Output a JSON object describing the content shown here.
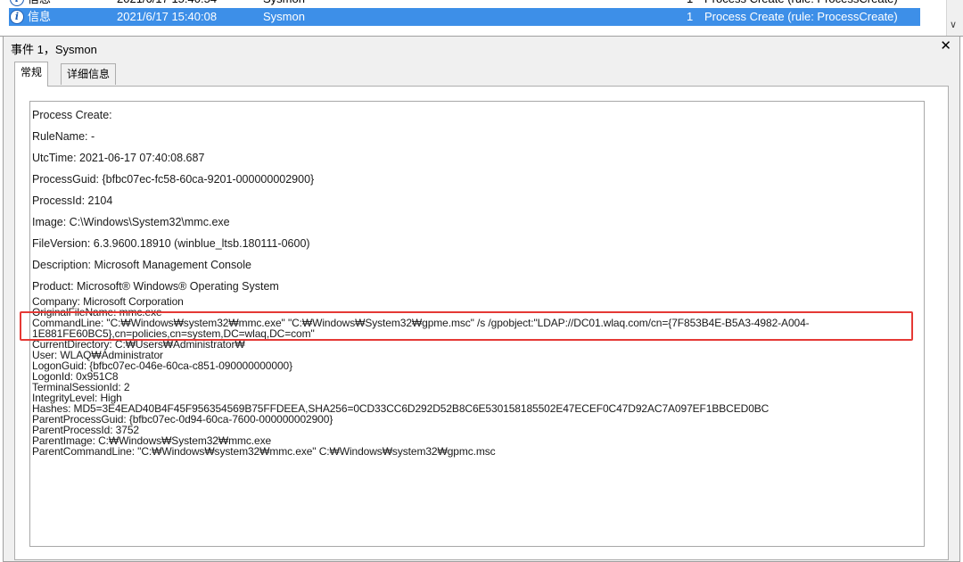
{
  "event_list": {
    "rows": [
      {
        "level": "信息",
        "datetime": "2021/6/17 15:40:54",
        "source": "Sysmon",
        "event_id": "1",
        "task_category": "Process Create (rule: ProcessCreate)",
        "selected": false
      },
      {
        "level": "信息",
        "datetime": "2021/6/17 15:40:08",
        "source": "Sysmon",
        "event_id": "1",
        "task_category": "Process Create (rule: ProcessCreate)",
        "selected": true
      }
    ],
    "info_icon_glyph": "i",
    "scroll_down_glyph": "∨",
    "icon": "info-icon",
    "selection_color": "#3d8fe8"
  },
  "detail_pane": {
    "title": "事件 1，Sysmon",
    "close_glyph": "✕",
    "tabs": {
      "general": "常规",
      "details": "详细信息"
    },
    "fields": [
      "Process Create:",
      "RuleName: -",
      "UtcTime: 2021-06-17 07:40:08.687",
      "ProcessGuid: {bfbc07ec-fc58-60ca-9201-000000002900}",
      "ProcessId: 2104",
      "Image: C:\\Windows\\System32\\mmc.exe",
      "FileVersion: 6.3.9600.18910 (winblue_ltsb.180111-0600)",
      "Description: Microsoft Management Console",
      "Product: Microsoft® Windows® Operating System"
    ],
    "raw_lines": [
      "Company: Microsoft Corporation",
      "OriginalFileName: mmc.exe",
      "CommandLine: \"C:₩Windows₩system32₩mmc.exe\" \"C:₩Windows₩System32₩gpme.msc\" /s /gpobject:\"LDAP://DC01.wlaq.com/cn={7F853B4E-B5A3-4982-A004-",
      "1E881FE60BC5},cn=policies,cn=system,DC=wlaq,DC=com\"",
      "CurrentDirectory: C:₩Users₩Administrator₩",
      "User: WLAQ₩Administrator",
      "LogonGuid: {bfbc07ec-046e-60ca-c851-090000000000}",
      "LogonId: 0x951C8",
      "TerminalSessionId: 2",
      "IntegrityLevel: High",
      "Hashes: MD5=3E4EAD40B4F45F956354569B75FFDEEA,SHA256=0CD33CC6D292D52B8C6E530158185502E47ECEF0C47D92AC7A097EF1BBCED0BC",
      "ParentProcessGuid: {bfbc07ec-0d94-60ca-7600-000000002900}",
      "ParentProcessId: 3752",
      "ParentImage: C:₩Windows₩System32₩mmc.exe",
      "ParentCommandLine: \"C:₩Windows₩system32₩mmc.exe\" C:₩Windows₩system32₩gpmc.msc"
    ],
    "highlight_color": "#e53935"
  }
}
